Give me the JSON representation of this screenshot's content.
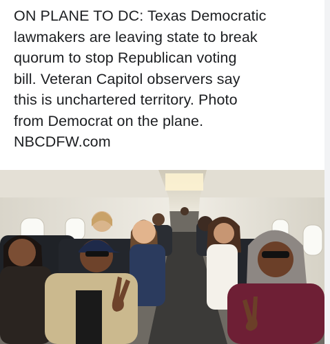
{
  "post": {
    "text_lines": [
      "ON PLANE TO DC: Texas Democratic",
      "lawmakers are leaving state to break",
      "quorum to stop Republican voting",
      "bill. Veteran Capitol observers say",
      "this is unchartered territory. Photo",
      "from Democrat on the plane.",
      "NBCDFW.com"
    ]
  },
  "colors": {
    "text": "#1c1e21",
    "background": "#ffffff",
    "cabin_ceiling": "#dcd8cc",
    "cabin_wall": "#e9e6de",
    "seat_dark": "#1f2227",
    "aisle_carpet": "#3b3a38"
  }
}
